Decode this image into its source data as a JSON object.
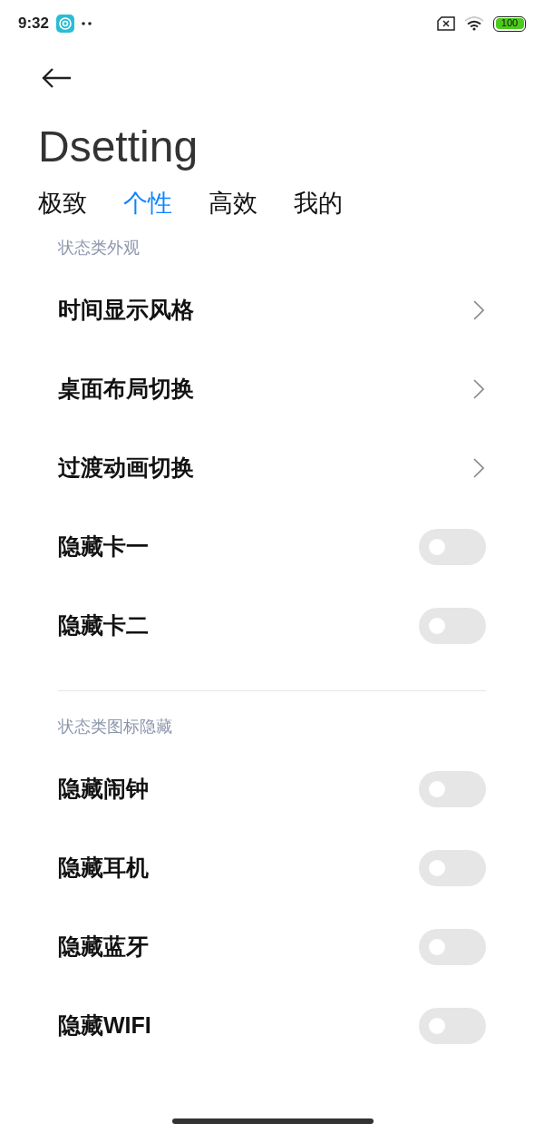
{
  "status_bar": {
    "time": "9:32",
    "battery": "100"
  },
  "title": "Dsetting",
  "tabs": [
    {
      "label": "极致",
      "selected": false
    },
    {
      "label": "个性",
      "selected": true
    },
    {
      "label": "高效",
      "selected": false
    },
    {
      "label": "我的",
      "selected": false
    }
  ],
  "sections": [
    {
      "header": "状态类外观",
      "items": [
        {
          "kind": "link",
          "label": "时间显示风格"
        },
        {
          "kind": "link",
          "label": "桌面布局切换"
        },
        {
          "kind": "link",
          "label": "过渡动画切换"
        },
        {
          "kind": "switch",
          "label": "隐藏卡一",
          "on": false
        },
        {
          "kind": "switch",
          "label": "隐藏卡二",
          "on": false
        }
      ]
    },
    {
      "header": "状态类图标隐藏",
      "items": [
        {
          "kind": "switch",
          "label": "隐藏闹钟",
          "on": false
        },
        {
          "kind": "switch",
          "label": "隐藏耳机",
          "on": false
        },
        {
          "kind": "switch",
          "label": "隐藏蓝牙",
          "on": false
        },
        {
          "kind": "switch",
          "label": "隐藏WIFI",
          "on": false
        }
      ]
    }
  ]
}
